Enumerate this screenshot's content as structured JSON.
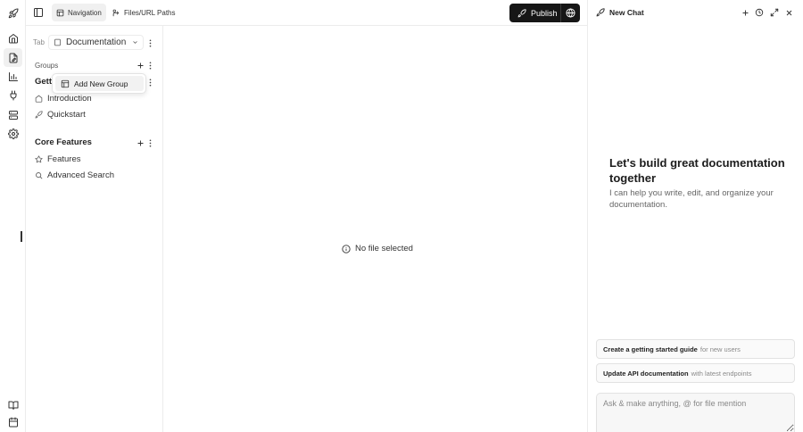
{
  "rail": {
    "items": [
      {
        "icon": "rocket-icon"
      },
      {
        "icon": "home-icon"
      },
      {
        "icon": "edit-page-icon"
      },
      {
        "icon": "analytics-icon"
      },
      {
        "icon": "plug-icon"
      },
      {
        "icon": "database-icon"
      },
      {
        "icon": "settings-icon"
      }
    ],
    "bottom": [
      {
        "icon": "book-icon"
      },
      {
        "icon": "calendar-icon"
      }
    ]
  },
  "topbar": {
    "tabs": [
      {
        "label": "Navigation",
        "active": true
      },
      {
        "label": "Files/URL Paths",
        "active": false
      }
    ],
    "publish_label": "Publish"
  },
  "nav": {
    "tab_label": "Tab",
    "tab_value": "Documentation",
    "groups_label": "Groups",
    "groups": [
      {
        "title": "Getting Started",
        "pages": [
          {
            "label": "Introduction",
            "icon": "home-icon"
          },
          {
            "label": "Quickstart",
            "icon": "rocket-icon"
          }
        ]
      },
      {
        "title": "Core Features",
        "pages": [
          {
            "label": "Features",
            "icon": "star-icon"
          },
          {
            "label": "Advanced Search",
            "icon": "search-icon"
          }
        ]
      }
    ],
    "menu": {
      "add_group_label": "Add New Group"
    },
    "visible_group_title": "Gett"
  },
  "main": {
    "empty_text": "No file selected"
  },
  "chat": {
    "title": "New Chat",
    "welcome_title": "Let's build great documentation together",
    "welcome_sub": "I can help you write, edit, and organize your documentation.",
    "suggestions": [
      {
        "strong": "Create a getting started guide",
        "light": "for new users"
      },
      {
        "strong": "Update API documentation",
        "light": "with latest endpoints"
      }
    ],
    "input_placeholder": "Ask & make anything, @ for file mention"
  },
  "colors": {
    "accent_dark": "#161616",
    "border": "#ececec"
  }
}
